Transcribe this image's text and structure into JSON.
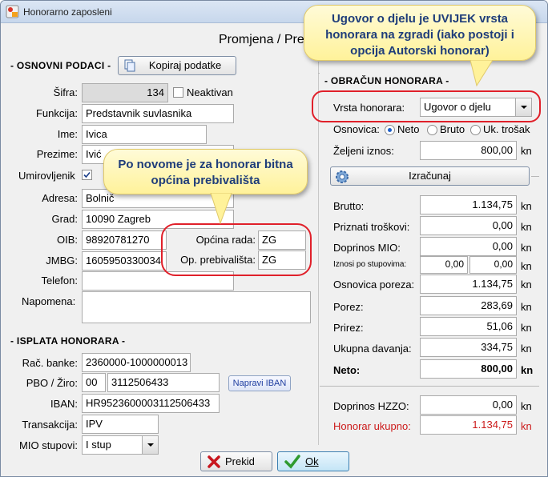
{
  "window": {
    "title": "Honorarno zaposleni"
  },
  "header": {
    "title": "Promjena / Pre"
  },
  "osnovni": {
    "section_title": "- OSNOVNI PODACI -",
    "copy_button": "Kopiraj podatke",
    "sifra_label": "Šifra:",
    "sifra_value": "134",
    "neaktivan_label": "Neaktivan",
    "neaktivan_checked": false,
    "funkcija_label": "Funkcija:",
    "funkcija_value": "Predstavnik suvlasnika",
    "ime_label": "Ime:",
    "ime_value": "Ivica",
    "prezime_label": "Prezime:",
    "prezime_value": "Ivić",
    "umirovljenik_label": "Umirovljenik",
    "umirovljenik_checked": true,
    "adresa_label": "Adresa:",
    "adresa_value": "Bolnič",
    "grad_label": "Grad:",
    "grad_value": "10090 Zagreb",
    "oib_label": "OIB:",
    "oib_value": "98920781270",
    "jmbg_label": "JMBG:",
    "jmbg_value": "1605950330034",
    "opcina_rada_label": "Općina rada:",
    "opcina_rada_value": "ZG",
    "op_prebivalista_label": "Op. prebivališta:",
    "op_prebivalista_value": "ZG",
    "telefon_label": "Telefon:",
    "telefon_value": "",
    "napomena_label": "Napomena:",
    "napomena_value": ""
  },
  "isplata": {
    "section_title": "- ISPLATA HONORARA -",
    "rac_banke_label": "Rač. banke:",
    "rac_banke_value": "2360000-1000000013",
    "pbo_label": "PBO / Žiro:",
    "pbo_model": "00",
    "pbo_value": "3112506433",
    "iban_button": "Napravi IBAN",
    "iban_label": "IBAN:",
    "iban_value": "HR9523600003112506433",
    "transakcija_label": "Transakcija:",
    "transakcija_value": "IPV",
    "mio_label": "MIO stupovi:",
    "mio_value": "I stup"
  },
  "obracun": {
    "section_title": "- OBRAČUN HONORARA -",
    "vrsta_label": "Vrsta honorara:",
    "vrsta_value": "Ugovor o djelu",
    "osnovica_label": "Osnovica:",
    "osnovica_options": [
      "Neto",
      "Bruto",
      "Uk. trošak"
    ],
    "osnovica_selected": "Neto",
    "zeljeni_label": "Željeni iznos:",
    "zeljeni_value": "800,00",
    "unit": "kn",
    "izracunaj_button": "Izračunaj",
    "bruto_label": "Brutto:",
    "bruto_value": "1.134,75",
    "priznati_label": "Priznati troškovi:",
    "priznati_value": "0,00",
    "doprinos_mio_label": "Doprinos MIO:",
    "doprinos_mio_value": "0,00",
    "iznosi_label": "Iznosi po stupovima:",
    "iznosi_value_1": "0,00",
    "iznosi_value_2": "0,00",
    "osnovica_poreza_label": "Osnovica poreza:",
    "osnovica_poreza_value": "1.134,75",
    "porez_label": "Porez:",
    "porez_value": "283,69",
    "prirez_label": "Prirez:",
    "prirez_value": "51,06",
    "ukupna_davanja_label": "Ukupna davanja:",
    "ukupna_davanja_value": "334,75",
    "neto_label": "Neto:",
    "neto_value": "800,00",
    "doprinos_hzzo_label": "Doprinos HZZO:",
    "doprinos_hzzo_value": "0,00",
    "honorar_ukupno_label": "Honorar ukupno:",
    "honorar_ukupno_value": "1.134,75",
    "honorar_ukupno_color": "#cc1a1a"
  },
  "footer": {
    "prekid_button": "Prekid",
    "ok_button": "Ok"
  },
  "callouts": {
    "top_right": "Ugovor o djelu je UVIJEK vrsta honorara na zgradi (iako postoji i opcija Autorski honorar)",
    "middle": "Po novome je za honorar bitna općina prebivališta"
  },
  "colors": {
    "accent_red": "#e0202a",
    "callout_text": "#1f3d7a"
  }
}
